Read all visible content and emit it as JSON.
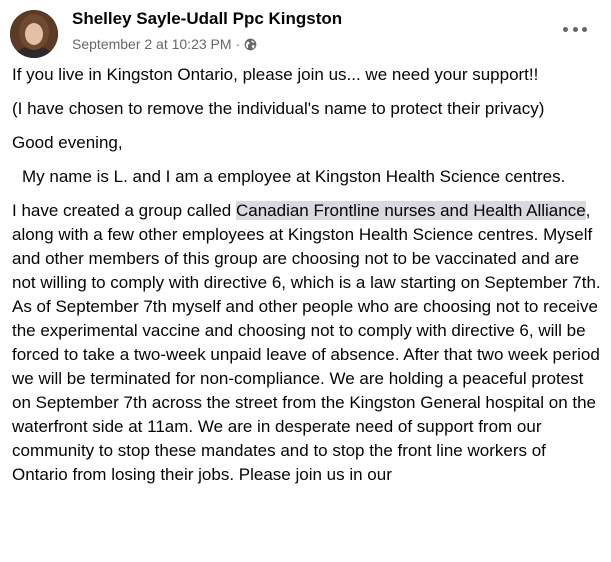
{
  "post": {
    "author": "Shelley Sayle-Udall Ppc Kingston",
    "timestamp": "September 2 at 10:23 PM",
    "separator": "·",
    "audience_icon": "globe-icon",
    "more_icon": "more-options-icon",
    "paragraphs": {
      "p1": "If you live in Kingston Ontario, please join us... we need your support!!",
      "p2": "(I have chosen to remove the individual's name to protect their privacy)",
      "p3": "Good evening,",
      "p4": "My name is L. and I am a employee at Kingston Health Science centres.",
      "p5_before": "I have created a group called ",
      "p5_tag": "Canadian Frontline nurses and Health Alliance",
      "p5_after": ", along with a few other employees at Kingston Health Science centres. Myself and other members of this group are choosing not to be vaccinated and are not willing to comply with directive 6, which is a law starting on September 7th. As of September 7th myself and other people who are choosing not to receive the experimental vaccine and choosing not to comply with directive 6, will be forced to take a two-week unpaid leave of absence. After that two week period we will be terminated for non-compliance. We are holding a peaceful protest on September 7th across the street from the Kingston General hospital on the waterfront side at 11am. We are in desperate need of support from our community to stop these mandates and to stop the front line workers of Ontario from losing their jobs. Please join us in our"
    }
  },
  "colors": {
    "text": "#050505",
    "secondary_text": "#65676b",
    "tag_background": "#d8dadf"
  }
}
